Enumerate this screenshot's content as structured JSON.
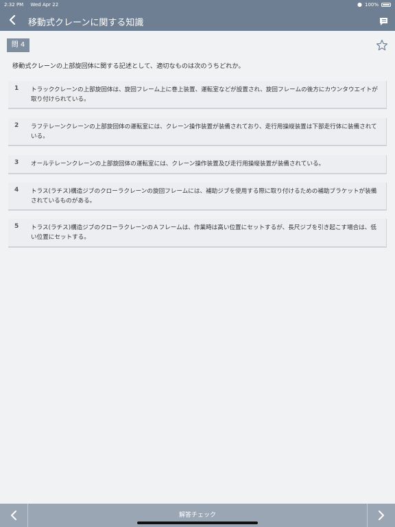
{
  "status_bar": {
    "time": "2:32 PM",
    "date": "Wed Apr 22",
    "battery": "100%"
  },
  "header": {
    "title": "移動式クレーンに関する知識"
  },
  "question": {
    "label": "問 4",
    "text": "移動式クレーンの上部旋回体に関する記述として、適切なものは次のうちどれか。"
  },
  "options": [
    {
      "num": "1",
      "text": "トラッククレーンの上部旋回体は、旋回フレーム上に巻上装置、運転室などが設置され、旋回フレームの後方にカウンタウエイトが取り付けられている。"
    },
    {
      "num": "2",
      "text": "ラフテレーンクレーンの上部旋回体の運転室には、クレーン操作装置が装備されており、走行用操縦装置は下部走行体に装備されている。"
    },
    {
      "num": "3",
      "text": "オールテレーンクレーンの上部旋回体の運転室には、クレーン操作装置及び走行用操縦装置が装備されている。"
    },
    {
      "num": "4",
      "text": "トラス(ラチス)構造ジブのクローラクレーンの旋回フレームには、補助ジブを使用する際に取り付けるための補助ブラケットが装備されているものがある。"
    },
    {
      "num": "5",
      "text": "トラス(ラチス)構造ジブのクローラクレーンのＡフレームは、作業時は高い位置にセットするが、長尺ジブを引き起こす場合は、低い位置にセットする。"
    }
  ],
  "footer": {
    "answer_check": "解答チェック"
  },
  "colors": {
    "header_bg": "#6e7f93",
    "badge_bg": "#7f8e9f",
    "footer_bg": "#9aa6b4"
  }
}
